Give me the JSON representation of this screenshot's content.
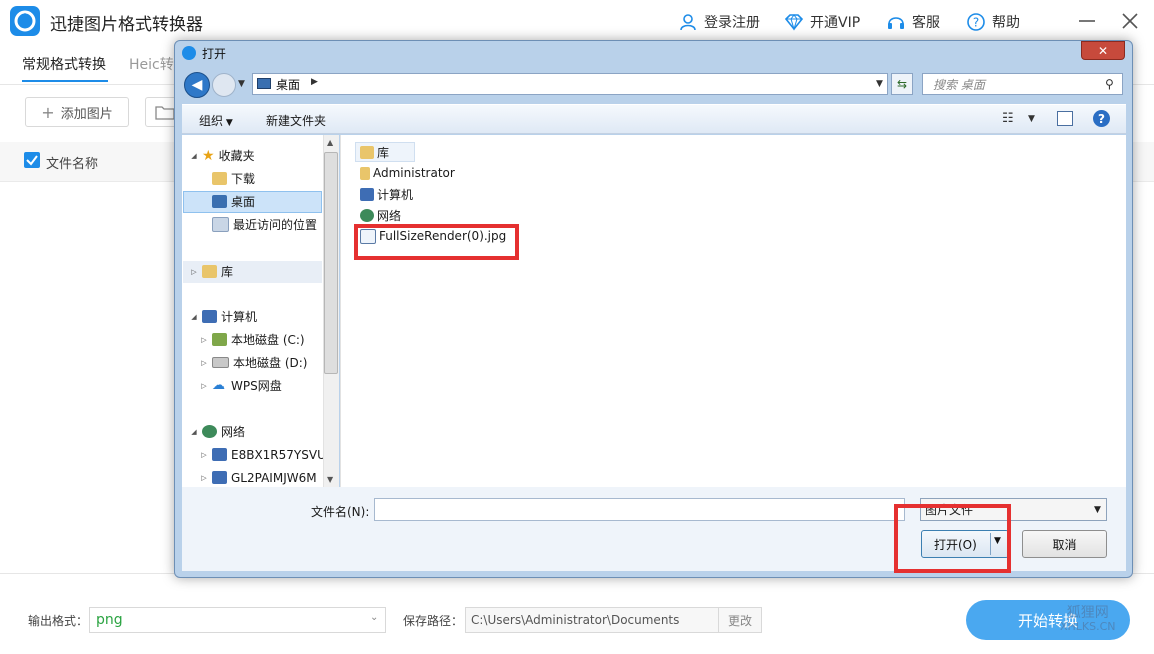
{
  "app": {
    "title": "迅捷图片格式转换器",
    "nav": {
      "login": "登录注册",
      "vip": "开通VIP",
      "service": "客服",
      "help": "帮助"
    },
    "tabs": {
      "active": "常规格式转换",
      "heic": "Heic转"
    },
    "add_image": "添加图片",
    "list_header": "文件名称",
    "output_format_label": "输出格式：",
    "output_format_value": "png",
    "save_path_label": "保存路径：",
    "save_path_value": "C:\\Users\\Administrator\\Documents",
    "change_label": "更改",
    "start_label": "开始转换",
    "watermark": {
      "line1": "狐狸网",
      "line2": "XHLKS.CN"
    }
  },
  "dialog": {
    "title": "打开",
    "address": "桌面",
    "search_placeholder": "搜索 桌面",
    "toolbar": {
      "organize": "组织",
      "new_folder": "新建文件夹"
    },
    "nav_tree": [
      {
        "label": "收藏夹"
      },
      {
        "label": "下载"
      },
      {
        "label": "桌面"
      },
      {
        "label": "最近访问的位置"
      },
      {
        "label": "库"
      },
      {
        "label": "计算机"
      },
      {
        "label": "本地磁盘 (C:)"
      },
      {
        "label": "本地磁盘 (D:)"
      },
      {
        "label": "WPS网盘"
      },
      {
        "label": "网络"
      },
      {
        "label": "E8BX1R57YSVU"
      },
      {
        "label": "GL2PAIMJW6M"
      }
    ],
    "files": [
      {
        "name": "库"
      },
      {
        "name": "Administrator"
      },
      {
        "name": "计算机"
      },
      {
        "name": "网络"
      },
      {
        "name": "FullSizeRender(0).jpg"
      }
    ],
    "filename_label": "文件名(N):",
    "filetype_value": "图片文件",
    "open_label": "打开(O)",
    "cancel_label": "取消"
  },
  "colors": {
    "accent": "#1d8ce8",
    "highlight": "#e53030",
    "format_text": "#2aa341"
  }
}
